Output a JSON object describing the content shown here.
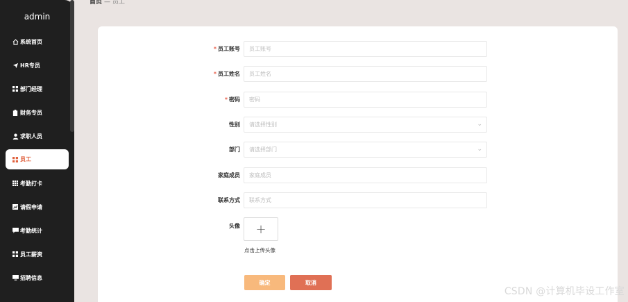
{
  "sidebar": {
    "brand": "admin",
    "items": [
      {
        "label": "系统首页",
        "icon": "home-icon"
      },
      {
        "label": "HR专员",
        "icon": "paper-plane-icon"
      },
      {
        "label": "部门经理",
        "icon": "grid-icon"
      },
      {
        "label": "财务专员",
        "icon": "clipboard-icon"
      },
      {
        "label": "求职人员",
        "icon": "user-icon"
      },
      {
        "label": "员工",
        "icon": "grid-icon",
        "active": true
      },
      {
        "label": "考勤打卡",
        "icon": "grid-icon"
      },
      {
        "label": "请假申请",
        "icon": "chart-icon"
      },
      {
        "label": "考勤统计",
        "icon": "comment-icon"
      },
      {
        "label": "员工薪资",
        "icon": "grid-icon"
      },
      {
        "label": "招聘信息",
        "icon": "monitor-icon"
      }
    ]
  },
  "breadcrumb": {
    "home": "首页",
    "sep": "—",
    "current": "员工"
  },
  "form": {
    "fields": [
      {
        "label": "员工账号",
        "required": true,
        "placeholder": "员工账号",
        "type": "text"
      },
      {
        "label": "员工姓名",
        "required": true,
        "placeholder": "员工姓名",
        "type": "text"
      },
      {
        "label": "密码",
        "required": true,
        "placeholder": "密码",
        "type": "text"
      },
      {
        "label": "性别",
        "required": false,
        "placeholder": "请选择性别",
        "type": "select"
      },
      {
        "label": "部门",
        "required": false,
        "placeholder": "请选择部门",
        "type": "select"
      },
      {
        "label": "家庭成员",
        "required": false,
        "placeholder": "家庭成员",
        "type": "text"
      },
      {
        "label": "联系方式",
        "required": false,
        "placeholder": "联系方式",
        "type": "text"
      }
    ],
    "avatar_label": "头像",
    "upload_plus": "+",
    "upload_tip": "点击上传头像",
    "confirm": "确定",
    "cancel": "取消",
    "required_mark": "*",
    "select_chevron": "⌄"
  },
  "watermark": "CSDN @计算机毕设工作室",
  "colors": {
    "accent": "#e0623f",
    "confirm": "#f8b97c",
    "cancel": "#e07055",
    "sidebar": "#1f1f1f"
  }
}
